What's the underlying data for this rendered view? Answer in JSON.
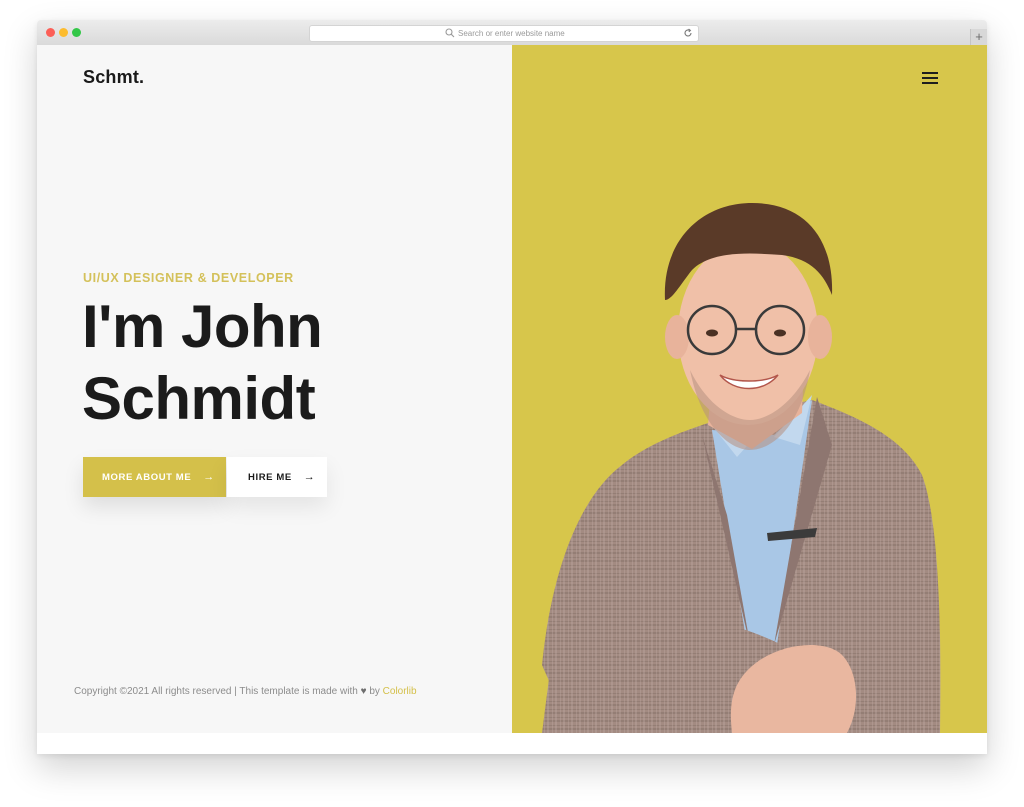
{
  "browser": {
    "address_placeholder": "Search or enter website name",
    "new_tab_symbol": "+"
  },
  "header": {
    "logo": "Schmt.",
    "menu_icon": "hamburger-menu-icon"
  },
  "hero": {
    "subtitle": "UI/UX DESIGNER & DEVELOPER",
    "name_line1": "I'm John",
    "name_line2": "Schmidt",
    "buttons": {
      "more_about": "MORE ABOUT ME",
      "hire": "HIRE ME",
      "arrow": "→"
    },
    "photo": "portrait-photo"
  },
  "footer": {
    "copyright_text": "Copyright ©2021 All rights reserved | This template is made with",
    "heart": "♥",
    "by_text": "by",
    "brand": "Colorlib"
  },
  "colors": {
    "accent": "#d7c64b",
    "text_dark": "#1b1b1b",
    "page_bg": "#f7f7f7"
  }
}
